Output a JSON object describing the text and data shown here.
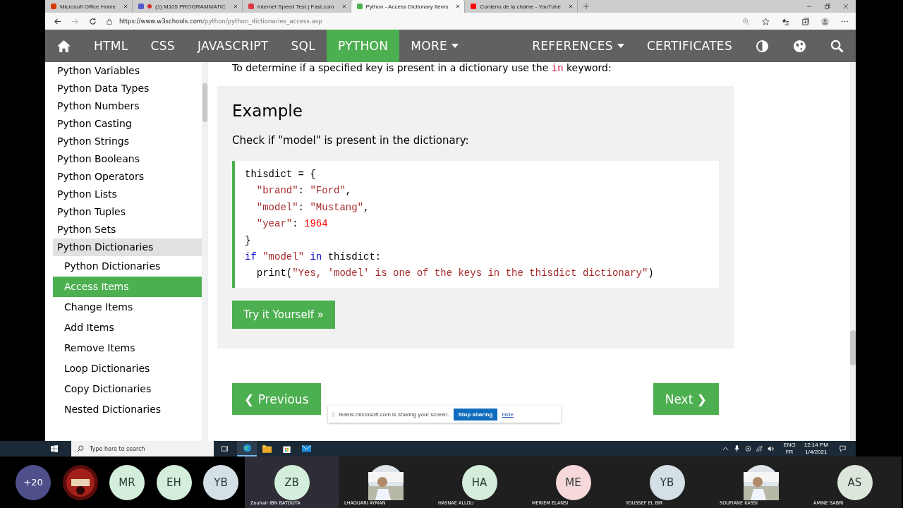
{
  "browser": {
    "tabs": [
      {
        "label": "Microsoft Office Home",
        "selected": false
      },
      {
        "label": "(1) M105 PROGRAMMATIC",
        "selected": false
      },
      {
        "label": "Internet Speed Test | Fast.com",
        "selected": false
      },
      {
        "label": "Python - Access Dictionary Items",
        "selected": true
      },
      {
        "label": "Contenu de la chaîne - YouTube",
        "selected": false
      }
    ],
    "address": {
      "host": "https://www.w3schools.com",
      "path": "/python/python_dictionaries_access.asp"
    }
  },
  "nav": {
    "items": [
      {
        "label": "HTML",
        "selected": false,
        "kind": "link"
      },
      {
        "label": "CSS",
        "selected": false,
        "kind": "link"
      },
      {
        "label": "JAVASCRIPT",
        "selected": false,
        "kind": "link"
      },
      {
        "label": "SQL",
        "selected": false,
        "kind": "link"
      },
      {
        "label": "PYTHON",
        "selected": true,
        "kind": "link"
      },
      {
        "label": "MORE",
        "selected": false,
        "kind": "dropdown"
      }
    ],
    "right_items": [
      {
        "label": "REFERENCES",
        "kind": "dropdown"
      },
      {
        "label": "CERTIFICATES",
        "kind": "link"
      }
    ]
  },
  "sidebar": {
    "items": [
      {
        "label": "Python Variables",
        "selected": false,
        "expanded": false
      },
      {
        "label": "Python Data Types",
        "selected": false,
        "expanded": false
      },
      {
        "label": "Python Numbers",
        "selected": false,
        "expanded": false
      },
      {
        "label": "Python Casting",
        "selected": false,
        "expanded": false
      },
      {
        "label": "Python Strings",
        "selected": false,
        "expanded": false
      },
      {
        "label": "Python Booleans",
        "selected": false,
        "expanded": false
      },
      {
        "label": "Python Operators",
        "selected": false,
        "expanded": false
      },
      {
        "label": "Python Lists",
        "selected": false,
        "expanded": false
      },
      {
        "label": "Python Tuples",
        "selected": false,
        "expanded": false
      },
      {
        "label": "Python Sets",
        "selected": false,
        "expanded": false
      },
      {
        "label": "Python Dictionaries",
        "selected": false,
        "expanded": true,
        "children": [
          {
            "label": "Python Dictionaries",
            "selected": false
          },
          {
            "label": "Access Items",
            "selected": true
          },
          {
            "label": "Change Items",
            "selected": false
          },
          {
            "label": "Add Items",
            "selected": false
          },
          {
            "label": "Remove Items",
            "selected": false
          },
          {
            "label": "Loop Dictionaries",
            "selected": false
          },
          {
            "label": "Copy Dictionaries",
            "selected": false
          },
          {
            "label": "Nested Dictionaries",
            "selected": false
          }
        ]
      }
    ]
  },
  "content": {
    "intro": [
      {
        "text": "To determine if a specified key is present in a dictionary use the ",
        "kind": "plain"
      },
      {
        "text": "in",
        "kind": "code"
      },
      {
        "text": " keyword:",
        "kind": "plain"
      }
    ],
    "example": {
      "heading": "Example",
      "description": "Check if \"model\" is present in the dictionary:",
      "code": [
        [
          {
            "text": "thisdict = {",
            "kind": "plain"
          }
        ],
        [
          {
            "text": "\"brand\"",
            "kind": "string",
            "indented": true
          },
          {
            "text": ": ",
            "kind": "plain"
          },
          {
            "text": "\"Ford\"",
            "kind": "string"
          },
          {
            "text": ",",
            "kind": "plain"
          }
        ],
        [
          {
            "text": "\"model\"",
            "kind": "string",
            "indented": true
          },
          {
            "text": ": ",
            "kind": "plain"
          },
          {
            "text": "\"Mustang\"",
            "kind": "string"
          },
          {
            "text": ",",
            "kind": "plain"
          }
        ],
        [
          {
            "text": "\"year\"",
            "kind": "string",
            "indented": true
          },
          {
            "text": ": ",
            "kind": "plain"
          },
          {
            "text": "1964",
            "kind": "number"
          }
        ],
        [
          {
            "text": "}",
            "kind": "plain"
          }
        ],
        [
          {
            "text": "if ",
            "kind": "keyword"
          },
          {
            "text": "\"model\"",
            "kind": "string"
          },
          {
            "text": " in",
            "kind": "keyword"
          },
          {
            "text": " thisdict:",
            "kind": "plain"
          }
        ],
        [
          {
            "text": "print(",
            "kind": "plain",
            "indented": true
          },
          {
            "text": "\"Yes, 'model' is one of the keys in the thisdict dictionary\"",
            "kind": "string"
          },
          {
            "text": ")",
            "kind": "plain"
          }
        ]
      ],
      "button": "Try it Yourself »"
    },
    "previous": "❮ Previous",
    "next": "Next ❯"
  },
  "share_bar": {
    "message": "teams.microsoft.com is sharing your screen.",
    "stop": "Stop sharing",
    "hide": "Hide"
  },
  "taskbar": {
    "search": {
      "placeholder": "Type here to search"
    },
    "language": "ENG",
    "layout": "FR",
    "time": "12:14 PM",
    "date": "1/4/2021"
  },
  "meeting": {
    "overflow": "+20",
    "roster": [
      {
        "kind": "picture"
      },
      {
        "initials": "MR",
        "kind": "avatar",
        "color": "#d4eedc"
      },
      {
        "initials": "EH",
        "kind": "avatar",
        "color": "#d4eedc"
      },
      {
        "initials": "YB",
        "kind": "avatar",
        "color": "#d5dfe6"
      }
    ],
    "tiles": [
      {
        "initials": "ZB",
        "name": "Zouhair IBN BATOUTA",
        "kind": "avatar",
        "color": "#d4eedc",
        "selected": true
      },
      {
        "name": "LHAOUARI AYMAN",
        "kind": "picture",
        "selected": false
      },
      {
        "initials": "HA",
        "name": "HASNAE ALLOU",
        "kind": "avatar",
        "color": "#d4eedc",
        "selected": false
      },
      {
        "initials": "ME",
        "name": "MERIEM ELANSI",
        "kind": "avatar",
        "color": "#f6d7da",
        "selected": false
      },
      {
        "initials": "YB",
        "name": "YOUSSEF EL BIR",
        "kind": "avatar",
        "color": "#d5dfe6",
        "selected": false
      },
      {
        "name": "SOUFIANE KASSI",
        "kind": "picture",
        "selected": false
      },
      {
        "initials": "AS",
        "name": "AMINE SABRI",
        "kind": "avatar",
        "color": "#dde6da",
        "selected": false
      }
    ]
  }
}
